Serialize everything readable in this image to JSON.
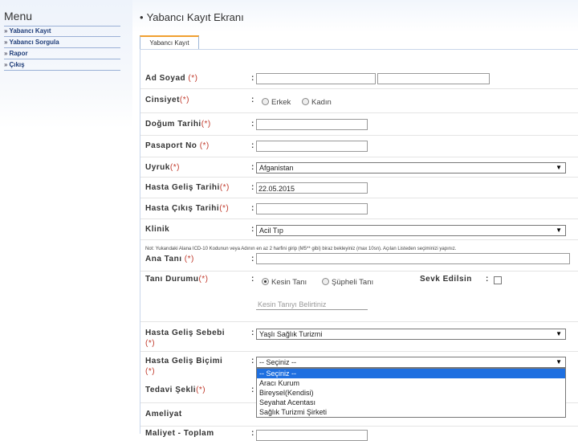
{
  "menu": {
    "title": "Menu",
    "items": [
      {
        "label": "Yabancı Kayıt"
      },
      {
        "label": "Yabancı Sorgula"
      },
      {
        "label": "Rapor"
      },
      {
        "label": "Çıkış"
      }
    ]
  },
  "header": {
    "title": "Yabancı Kayıt Ekranı"
  },
  "tab": {
    "label": "Yabancı Kayıt"
  },
  "form": {
    "ad_soyad": {
      "label": "Ad Soyad",
      "req": "(*)",
      "value1": "",
      "value2": ""
    },
    "cinsiyet": {
      "label": "Cinsiyet",
      "req": "(*)",
      "options": [
        "Erkek",
        "Kadın"
      ]
    },
    "dogum_tarihi": {
      "label": "Doğum Tarihi",
      "req": "(*)",
      "value": ""
    },
    "pasaport_no": {
      "label": "Pasaport No",
      "req": "(*)",
      "value": ""
    },
    "uyruk": {
      "label": "Uyruk",
      "req": "(*)",
      "value": "Afganistan"
    },
    "gelis_tarihi": {
      "label": "Hasta Geliş Tarihi",
      "req": "(*)",
      "value": "22.05.2015"
    },
    "cikis_tarihi": {
      "label": "Hasta Çıkış Tarihi",
      "req": "(*)",
      "value": ""
    },
    "klinik": {
      "label": "Klinik",
      "value": "Acil Tıp"
    },
    "note": "Not: Yukarıdaki Alana ICD-10 Kodunun veya Adının en az 2 harfini girip (M5** gibi) biraz bekleyiniz (max 10sn). Açılan Listeden seçiminizi yapınız.",
    "ana_tani": {
      "label": "Ana Tanı",
      "req": "(*)",
      "value": ""
    },
    "tani_durumu": {
      "label": "Tanı Durumu",
      "req": "(*)",
      "options": [
        "Kesin Tanı",
        "Şüpheli Tanı"
      ],
      "placeholder": "Kesin Tanıyı Belirtiniz"
    },
    "sevk": {
      "label": "Sevk Edilsin"
    },
    "gelis_sebebi": {
      "label": "Hasta Geliş Sebebi",
      "req": "(*)",
      "value": "Yaşlı Sağlık Turizmi"
    },
    "gelis_bicimi": {
      "label": "Hasta Geliş Biçimi",
      "req": "(*)",
      "value": "-- Seçiniz --",
      "options": [
        "-- Seçiniz --",
        "Aracı Kurum",
        "Bireysel(Kendisi)",
        "Seyahat Acentası",
        "Sağlık Turizmi Şirketi"
      ]
    },
    "tedavi_sekli": {
      "label": "Tedavi Şekli",
      "req": "(*)"
    },
    "ameliyat": {
      "label": "Ameliyat"
    },
    "cut_label": "Maliyet - Toplam",
    "colon": ":"
  },
  "icons": {
    "menu_bullet": "chevron-double-right-icon",
    "dropdown": "triangle-down-icon"
  },
  "colors": {
    "required": "#c0392b",
    "menu_text": "#1e3c78",
    "highlight": "#1e6fe0",
    "tab_accent": "#f0a030"
  }
}
